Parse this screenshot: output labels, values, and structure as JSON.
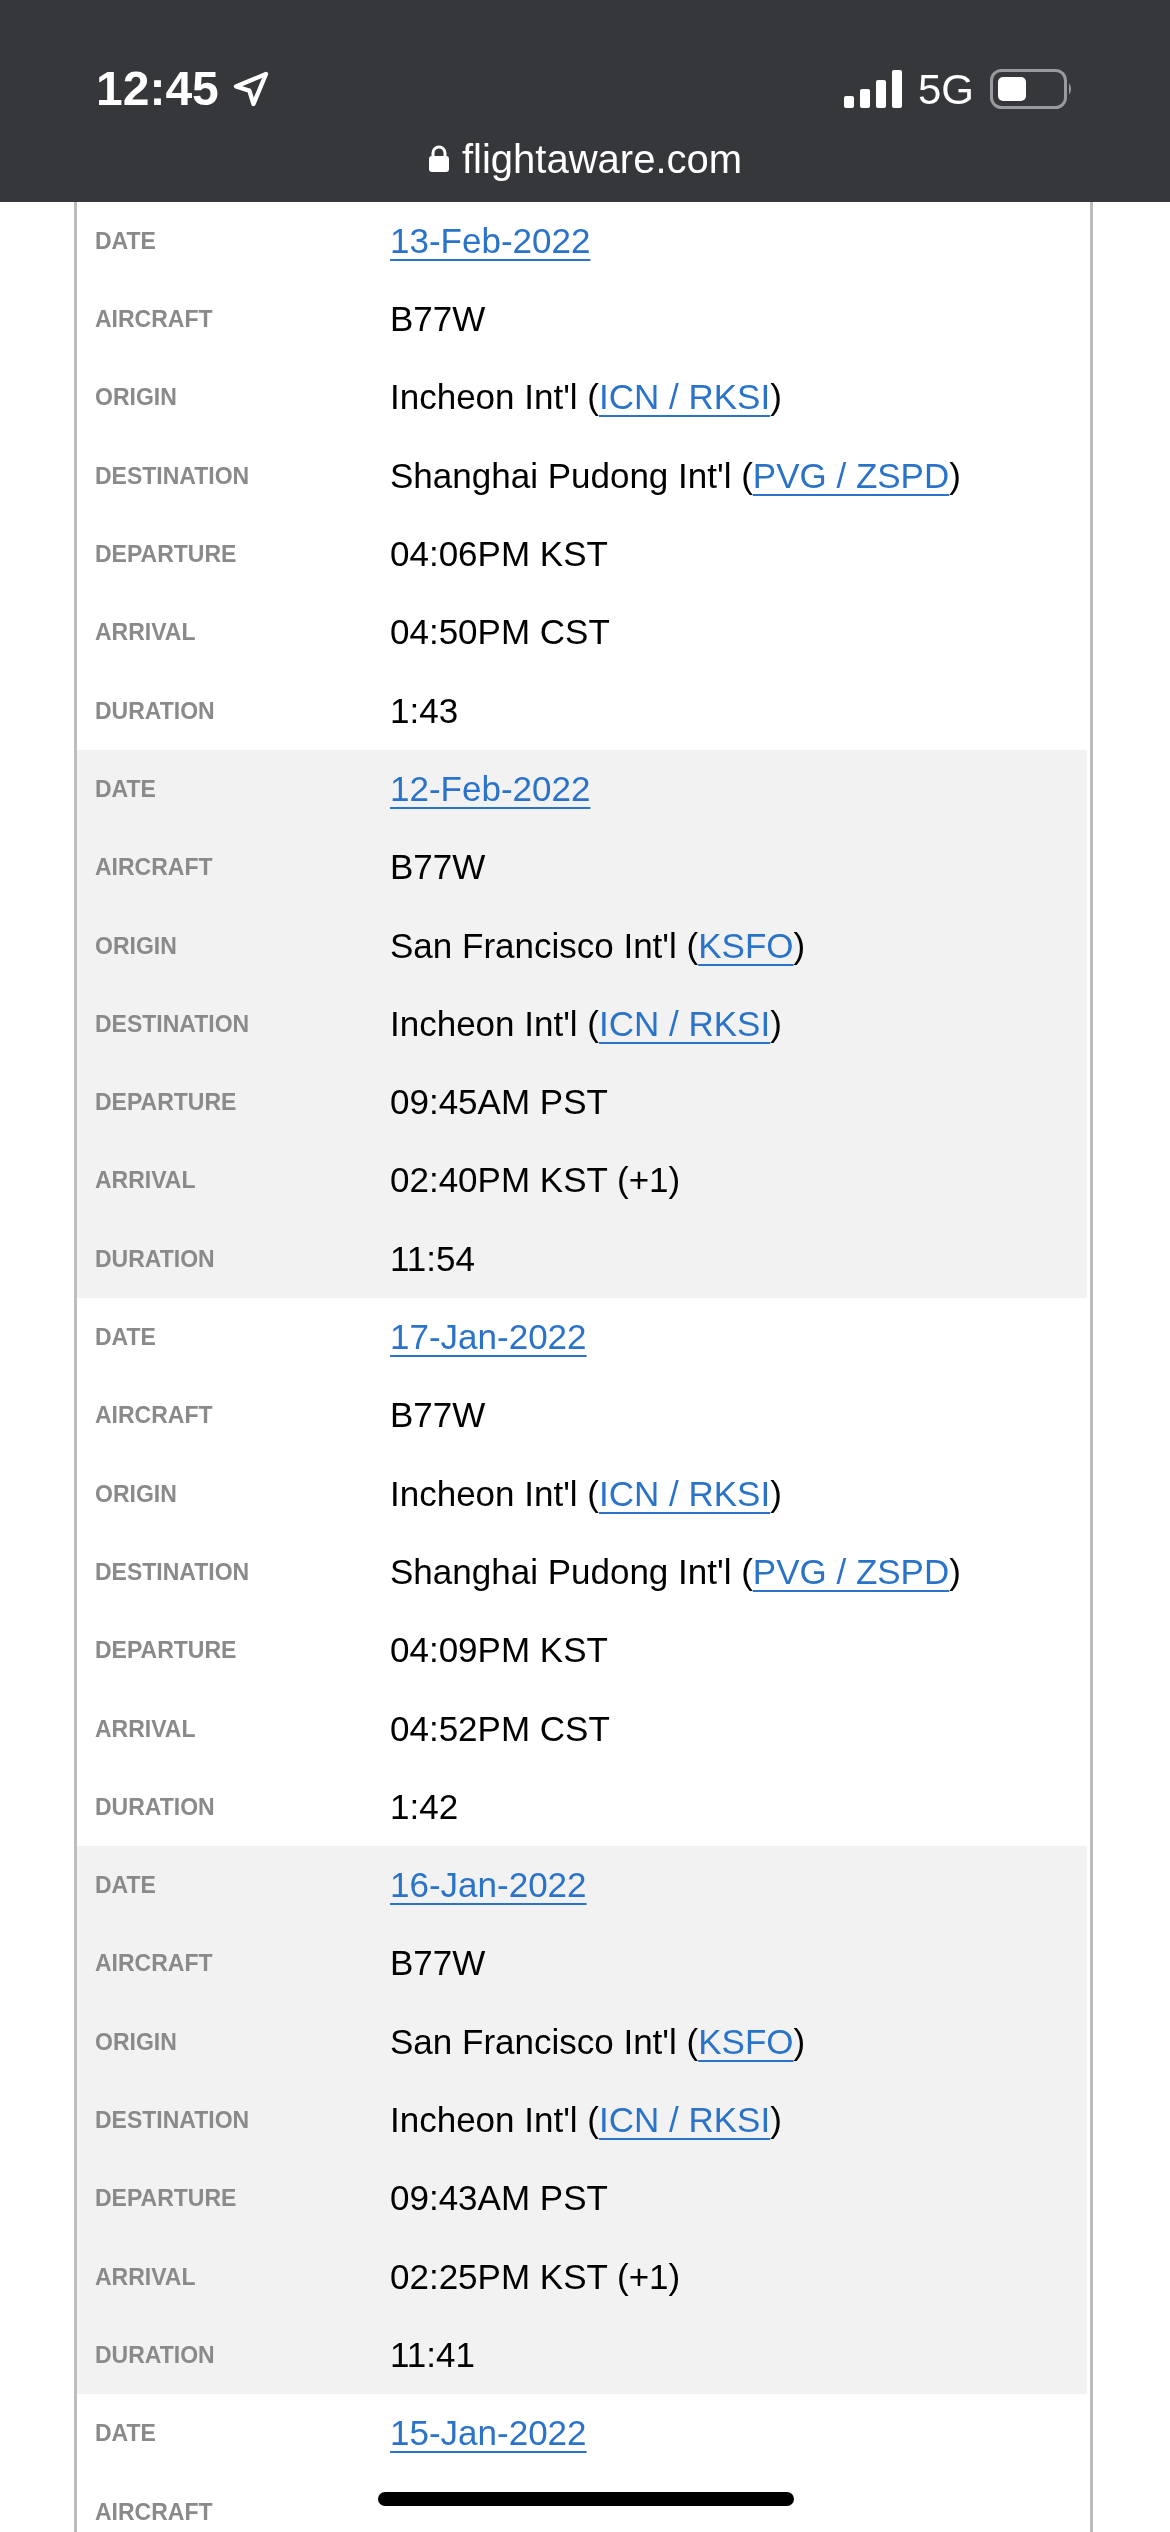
{
  "status_bar": {
    "time": "12:45",
    "network": "5G"
  },
  "address_bar": {
    "url": "flightaware.com"
  },
  "flights": [
    {
      "shaded": false,
      "rows": [
        {
          "label": "DATE",
          "value": [
            {
              "kind": "link",
              "text": "13-Feb-2022"
            }
          ]
        },
        {
          "label": "AIRCRAFT",
          "value": [
            {
              "kind": "text",
              "text": "B77W"
            }
          ]
        },
        {
          "label": "ORIGIN",
          "value": [
            {
              "kind": "text",
              "text": "Incheon Int'l ("
            },
            {
              "kind": "link",
              "text": "ICN / RKSI"
            },
            {
              "kind": "text",
              "text": ")"
            }
          ]
        },
        {
          "label": "DESTINATION",
          "value": [
            {
              "kind": "text",
              "text": "Shanghai Pudong Int'l ("
            },
            {
              "kind": "link",
              "text": "PVG / ZSPD"
            },
            {
              "kind": "text",
              "text": ")"
            }
          ]
        },
        {
          "label": "DEPARTURE",
          "value": [
            {
              "kind": "text",
              "text": "04:06PM KST"
            }
          ]
        },
        {
          "label": "ARRIVAL",
          "value": [
            {
              "kind": "text",
              "text": "04:50PM CST"
            }
          ]
        },
        {
          "label": "DURATION",
          "value": [
            {
              "kind": "text",
              "text": "1:43"
            }
          ]
        }
      ]
    },
    {
      "shaded": true,
      "rows": [
        {
          "label": "DATE",
          "value": [
            {
              "kind": "link",
              "text": "12-Feb-2022"
            }
          ]
        },
        {
          "label": "AIRCRAFT",
          "value": [
            {
              "kind": "text",
              "text": "B77W"
            }
          ]
        },
        {
          "label": "ORIGIN",
          "value": [
            {
              "kind": "text",
              "text": "San Francisco Int'l ("
            },
            {
              "kind": "link",
              "text": "KSFO"
            },
            {
              "kind": "text",
              "text": ")"
            }
          ]
        },
        {
          "label": "DESTINATION",
          "value": [
            {
              "kind": "text",
              "text": "Incheon Int'l ("
            },
            {
              "kind": "link",
              "text": "ICN / RKSI"
            },
            {
              "kind": "text",
              "text": ")"
            }
          ]
        },
        {
          "label": "DEPARTURE",
          "value": [
            {
              "kind": "text",
              "text": "09:45AM PST"
            }
          ]
        },
        {
          "label": "ARRIVAL",
          "value": [
            {
              "kind": "text",
              "text": "02:40PM KST (+1)"
            }
          ]
        },
        {
          "label": "DURATION",
          "value": [
            {
              "kind": "text",
              "text": "11:54"
            }
          ]
        }
      ]
    },
    {
      "shaded": false,
      "rows": [
        {
          "label": "DATE",
          "value": [
            {
              "kind": "link",
              "text": "17-Jan-2022"
            }
          ]
        },
        {
          "label": "AIRCRAFT",
          "value": [
            {
              "kind": "text",
              "text": "B77W"
            }
          ]
        },
        {
          "label": "ORIGIN",
          "value": [
            {
              "kind": "text",
              "text": "Incheon Int'l ("
            },
            {
              "kind": "link",
              "text": "ICN / RKSI"
            },
            {
              "kind": "text",
              "text": ")"
            }
          ]
        },
        {
          "label": "DESTINATION",
          "value": [
            {
              "kind": "text",
              "text": "Shanghai Pudong Int'l ("
            },
            {
              "kind": "link",
              "text": "PVG / ZSPD"
            },
            {
              "kind": "text",
              "text": ")"
            }
          ]
        },
        {
          "label": "DEPARTURE",
          "value": [
            {
              "kind": "text",
              "text": "04:09PM KST"
            }
          ]
        },
        {
          "label": "ARRIVAL",
          "value": [
            {
              "kind": "text",
              "text": "04:52PM CST"
            }
          ]
        },
        {
          "label": "DURATION",
          "value": [
            {
              "kind": "text",
              "text": "1:42"
            }
          ]
        }
      ]
    },
    {
      "shaded": true,
      "rows": [
        {
          "label": "DATE",
          "value": [
            {
              "kind": "link",
              "text": "16-Jan-2022"
            }
          ]
        },
        {
          "label": "AIRCRAFT",
          "value": [
            {
              "kind": "text",
              "text": "B77W"
            }
          ]
        },
        {
          "label": "ORIGIN",
          "value": [
            {
              "kind": "text",
              "text": "San Francisco Int'l ("
            },
            {
              "kind": "link",
              "text": "KSFO"
            },
            {
              "kind": "text",
              "text": ")"
            }
          ]
        },
        {
          "label": "DESTINATION",
          "value": [
            {
              "kind": "text",
              "text": "Incheon Int'l ("
            },
            {
              "kind": "link",
              "text": "ICN / RKSI"
            },
            {
              "kind": "text",
              "text": ")"
            }
          ]
        },
        {
          "label": "DEPARTURE",
          "value": [
            {
              "kind": "text",
              "text": "09:43AM PST"
            }
          ]
        },
        {
          "label": "ARRIVAL",
          "value": [
            {
              "kind": "text",
              "text": "02:25PM KST (+1)"
            }
          ]
        },
        {
          "label": "DURATION",
          "value": [
            {
              "kind": "text",
              "text": "11:41"
            }
          ]
        }
      ]
    },
    {
      "shaded": false,
      "rows": [
        {
          "label": "DATE",
          "value": [
            {
              "kind": "link",
              "text": "15-Jan-2022"
            }
          ]
        },
        {
          "label": "AIRCRAFT"
        }
      ]
    }
  ]
}
